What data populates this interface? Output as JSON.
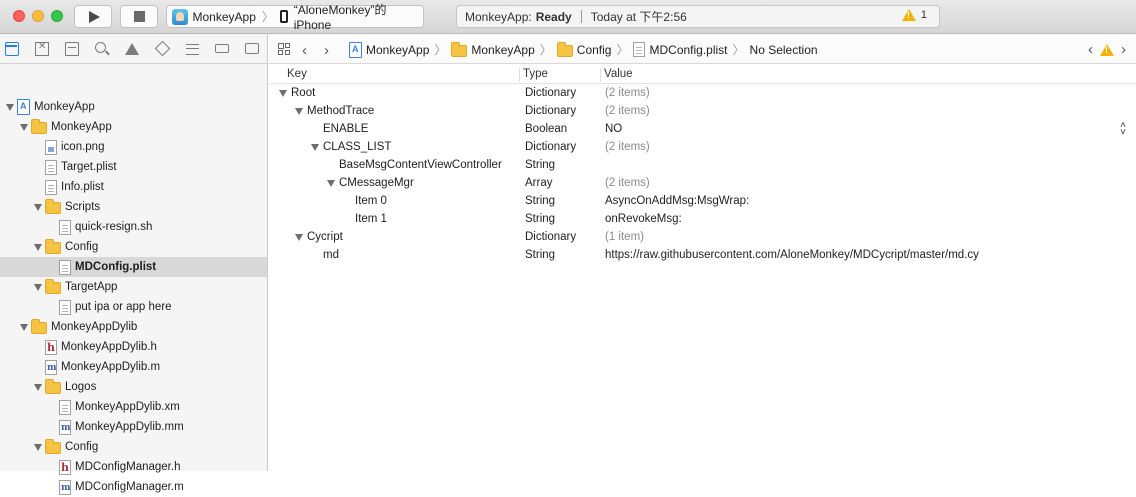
{
  "toolbar": {
    "scheme": {
      "app_name": "MonkeyApp",
      "device": "“AloneMonkey”的 iPhone"
    },
    "status": {
      "app": "MonkeyApp:",
      "state": "Ready",
      "time": "Today at 下午2:56",
      "warning_count": "1"
    }
  },
  "navigator": {
    "items": [
      {
        "label": "MonkeyApp",
        "icon": "project-icon",
        "level": 0,
        "expanded": true
      },
      {
        "label": "MonkeyApp",
        "icon": "folder-icon",
        "level": 1,
        "expanded": true
      },
      {
        "label": "icon.png",
        "icon": "image-file-icon",
        "level": 2
      },
      {
        "label": "Target.plist",
        "icon": "file-icon",
        "level": 2
      },
      {
        "label": "Info.plist",
        "icon": "file-icon",
        "level": 2
      },
      {
        "label": "Scripts",
        "icon": "folder-icon",
        "level": 2,
        "expanded": true
      },
      {
        "label": "quick-resign.sh",
        "icon": "file-icon",
        "level": 3
      },
      {
        "label": "Config",
        "icon": "folder-icon",
        "level": 2,
        "expanded": true
      },
      {
        "label": "MDConfig.plist",
        "icon": "file-icon",
        "level": 3,
        "selected": true
      },
      {
        "label": "TargetApp",
        "icon": "folder-icon",
        "level": 2,
        "expanded": true
      },
      {
        "label": "put ipa or app here",
        "icon": "file-icon",
        "level": 3
      },
      {
        "label": "MonkeyAppDylib",
        "icon": "folder-icon",
        "level": 1,
        "expanded": true
      },
      {
        "label": "MonkeyAppDylib.h",
        "icon": "header-file-icon",
        "level": 2
      },
      {
        "label": "MonkeyAppDylib.m",
        "icon": "source-file-icon",
        "level": 2
      },
      {
        "label": "Logos",
        "icon": "folder-icon",
        "level": 2,
        "expanded": true
      },
      {
        "label": "MonkeyAppDylib.xm",
        "icon": "file-icon",
        "level": 3
      },
      {
        "label": "MonkeyAppDylib.mm",
        "icon": "source-file-icon",
        "level": 3
      },
      {
        "label": "Config",
        "icon": "folder-icon",
        "level": 2,
        "expanded": true
      },
      {
        "label": "MDConfigManager.h",
        "icon": "header-file-icon",
        "level": 3
      },
      {
        "label": "MDConfigManager.m",
        "icon": "source-file-icon",
        "level": 3
      }
    ]
  },
  "jumpbar": {
    "crumbs": [
      "MonkeyApp",
      "MonkeyApp",
      "Config",
      "MDConfig.plist",
      "No Selection"
    ]
  },
  "plist": {
    "headers": {
      "key": "Key",
      "type": "Type",
      "value": "Value"
    },
    "rows": [
      {
        "key": "Root",
        "type": "Dictionary",
        "value": "(2 items)",
        "level": 0,
        "disclosure": true,
        "muted": true
      },
      {
        "key": "MethodTrace",
        "type": "Dictionary",
        "value": "(2 items)",
        "level": 1,
        "disclosure": true,
        "muted": true
      },
      {
        "key": "ENABLE",
        "type": "Boolean",
        "value": "NO",
        "level": 2,
        "disclosure": false,
        "muted": false,
        "stepper": true
      },
      {
        "key": "CLASS_LIST",
        "type": "Dictionary",
        "value": "(2 items)",
        "level": 2,
        "disclosure": true,
        "muted": true
      },
      {
        "key": "BaseMsgContentViewController",
        "type": "String",
        "value": "",
        "level": 3,
        "disclosure": false,
        "muted": false
      },
      {
        "key": "CMessageMgr",
        "type": "Array",
        "value": "(2 items)",
        "level": 3,
        "disclosure": true,
        "muted": true
      },
      {
        "key": "Item 0",
        "type": "String",
        "value": "AsyncOnAddMsg:MsgWrap:",
        "level": 4,
        "disclosure": false,
        "muted": false
      },
      {
        "key": "Item 1",
        "type": "String",
        "value": "onRevokeMsg:",
        "level": 4,
        "disclosure": false,
        "muted": false
      },
      {
        "key": "Cycript",
        "type": "Dictionary",
        "value": "(1 item)",
        "level": 1,
        "disclosure": true,
        "muted": true
      },
      {
        "key": "md",
        "type": "String",
        "value": "https://raw.githubusercontent.com/AloneMonkey/MDCycript/master/md.cy",
        "level": 2,
        "disclosure": false,
        "muted": false
      }
    ]
  }
}
